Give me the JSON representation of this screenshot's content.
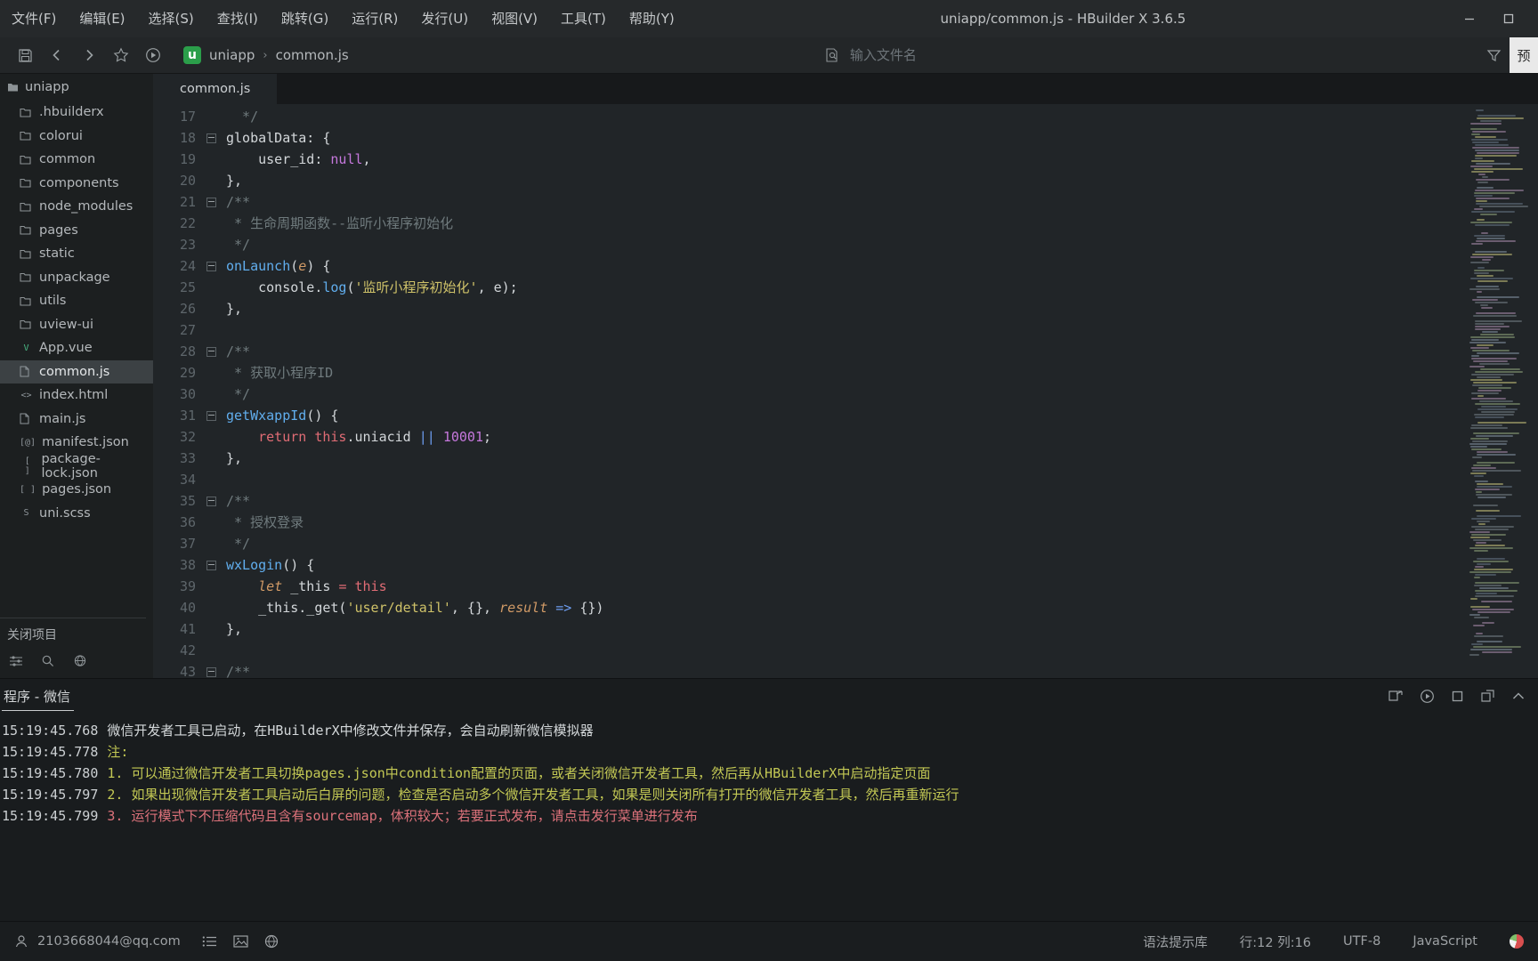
{
  "window": {
    "title": "uniapp/common.js - HBuilder X 3.6.5"
  },
  "menu_items": [
    "文件(F)",
    "编辑(E)",
    "选择(S)",
    "查找(I)",
    "跳转(G)",
    "运行(R)",
    "发行(U)",
    "视图(V)",
    "工具(T)",
    "帮助(Y)"
  ],
  "toolbar": {
    "breadcrumb": {
      "logo": "u",
      "project": "uniapp",
      "separator": "›",
      "file": "common.js"
    },
    "search": {
      "placeholder": "输入文件名"
    },
    "preview_button": "预"
  },
  "sidebar": {
    "root_label": "uniapp",
    "footer_label": "关闭项目",
    "items": [
      {
        "label": ".hbuilderx",
        "icon": "folder",
        "selected": false
      },
      {
        "label": "colorui",
        "icon": "folder",
        "selected": false
      },
      {
        "label": "common",
        "icon": "folder",
        "selected": false
      },
      {
        "label": "components",
        "icon": "folder",
        "selected": false
      },
      {
        "label": "node_modules",
        "icon": "folder",
        "selected": false
      },
      {
        "label": "pages",
        "icon": "folder",
        "selected": false
      },
      {
        "label": "static",
        "icon": "folder",
        "selected": false
      },
      {
        "label": "unpackage",
        "icon": "folder",
        "selected": false
      },
      {
        "label": "utils",
        "icon": "folder",
        "selected": false
      },
      {
        "label": "uview-ui",
        "icon": "folder",
        "selected": false
      },
      {
        "label": "App.vue",
        "icon": "vue",
        "selected": false
      },
      {
        "label": "common.js",
        "icon": "js",
        "selected": true
      },
      {
        "label": "index.html",
        "icon": "html",
        "selected": false
      },
      {
        "label": "main.js",
        "icon": "js",
        "selected": false
      },
      {
        "label": "manifest.json",
        "icon": "jsonat",
        "selected": false
      },
      {
        "label": "package-lock.json",
        "icon": "json",
        "selected": false
      },
      {
        "label": "pages.json",
        "icon": "json",
        "selected": false
      },
      {
        "label": "uni.scss",
        "icon": "scss",
        "selected": false
      }
    ]
  },
  "editor": {
    "active_tab": "common.js",
    "lines": [
      {
        "n": 17,
        "fold": false,
        "tokens": [
          [
            "c",
            "  */"
          ]
        ]
      },
      {
        "n": 18,
        "fold": true,
        "tokens": [
          [
            "d",
            "globalData: {"
          ]
        ]
      },
      {
        "n": 19,
        "fold": false,
        "tokens": [
          [
            "d",
            "    user_id: "
          ],
          [
            "p",
            "null"
          ],
          [
            "d",
            ","
          ]
        ]
      },
      {
        "n": 20,
        "fold": false,
        "tokens": [
          [
            "d",
            "},"
          ]
        ]
      },
      {
        "n": 21,
        "fold": true,
        "tokens": [
          [
            "c",
            "/**"
          ]
        ]
      },
      {
        "n": 22,
        "fold": false,
        "tokens": [
          [
            "c",
            " * 生命周期函数--监听小程序初始化"
          ]
        ]
      },
      {
        "n": 23,
        "fold": false,
        "tokens": [
          [
            "c",
            " */"
          ]
        ]
      },
      {
        "n": 24,
        "fold": true,
        "tokens": [
          [
            "b",
            "onLaunch"
          ],
          [
            "d",
            "("
          ],
          [
            "o",
            "e"
          ],
          [
            "d",
            ") {"
          ]
        ]
      },
      {
        "n": 25,
        "fold": false,
        "tokens": [
          [
            "d",
            "    console."
          ],
          [
            "b",
            "log"
          ],
          [
            "d",
            "("
          ],
          [
            "s",
            "'监听小程序初始化'"
          ],
          [
            "d",
            ", e);"
          ]
        ]
      },
      {
        "n": 26,
        "fold": false,
        "tokens": [
          [
            "d",
            "},"
          ]
        ]
      },
      {
        "n": 27,
        "fold": false,
        "tokens": []
      },
      {
        "n": 28,
        "fold": true,
        "tokens": [
          [
            "c",
            "/**"
          ]
        ]
      },
      {
        "n": 29,
        "fold": false,
        "tokens": [
          [
            "c",
            " * 获取小程序ID"
          ]
        ]
      },
      {
        "n": 30,
        "fold": false,
        "tokens": [
          [
            "c",
            " */"
          ]
        ]
      },
      {
        "n": 31,
        "fold": true,
        "tokens": [
          [
            "b",
            "getWxappId"
          ],
          [
            "d",
            "() {"
          ]
        ]
      },
      {
        "n": 32,
        "fold": false,
        "tokens": [
          [
            "d",
            "    "
          ],
          [
            "r",
            "return"
          ],
          [
            "d",
            " "
          ],
          [
            "r",
            "this"
          ],
          [
            "d",
            ".uniacid "
          ],
          [
            "op",
            "||"
          ],
          [
            "d",
            " "
          ],
          [
            "p",
            "10001"
          ],
          [
            "d",
            ";"
          ]
        ]
      },
      {
        "n": 33,
        "fold": false,
        "tokens": [
          [
            "d",
            "},"
          ]
        ]
      },
      {
        "n": 34,
        "fold": false,
        "tokens": []
      },
      {
        "n": 35,
        "fold": true,
        "tokens": [
          [
            "c",
            "/**"
          ]
        ]
      },
      {
        "n": 36,
        "fold": false,
        "tokens": [
          [
            "c",
            " * 授权登录"
          ]
        ]
      },
      {
        "n": 37,
        "fold": false,
        "tokens": [
          [
            "c",
            " */"
          ]
        ]
      },
      {
        "n": 38,
        "fold": true,
        "tokens": [
          [
            "b",
            "wxLogin"
          ],
          [
            "d",
            "() {"
          ]
        ]
      },
      {
        "n": 39,
        "fold": false,
        "tokens": [
          [
            "d",
            "    "
          ],
          [
            "o",
            "let"
          ],
          [
            "d",
            " _this "
          ],
          [
            "r",
            "="
          ],
          [
            "d",
            " "
          ],
          [
            "r",
            "this"
          ]
        ]
      },
      {
        "n": 40,
        "fold": false,
        "tokens": [
          [
            "d",
            "    _this._get("
          ],
          [
            "s",
            "'user/detail'"
          ],
          [
            "d",
            ", {}, "
          ],
          [
            "o",
            "result"
          ],
          [
            "d",
            " "
          ],
          [
            "op",
            "=>"
          ],
          [
            "d",
            " {})"
          ]
        ]
      },
      {
        "n": 41,
        "fold": false,
        "tokens": [
          [
            "d",
            "},"
          ]
        ]
      },
      {
        "n": 42,
        "fold": false,
        "tokens": []
      },
      {
        "n": 43,
        "fold": true,
        "tokens": [
          [
            "c",
            "/**"
          ]
        ]
      }
    ]
  },
  "console": {
    "active_tab": "程序 - 微信",
    "lines": [
      {
        "time": "15:19:45.768",
        "level": "info",
        "text": "微信开发者工具已启动，在HBuilderX中修改文件并保存，会自动刷新微信模拟器"
      },
      {
        "time": "15:19:45.778",
        "level": "warn",
        "text": "注:"
      },
      {
        "time": "15:19:45.780",
        "level": "warn",
        "text": "1. 可以通过微信开发者工具切换pages.json中condition配置的页面，或者关闭微信开发者工具，然后再从HBuilderX中启动指定页面"
      },
      {
        "time": "15:19:45.797",
        "level": "warn",
        "text": "2. 如果出现微信开发者工具启动后白屏的问题，检查是否启动多个微信开发者工具，如果是则关闭所有打开的微信开发者工具，然后再重新运行"
      },
      {
        "time": "15:19:45.799",
        "level": "error",
        "text": "3. 运行模式下不压缩代码且含有sourcemap，体积较大；若要正式发布，请点击发行菜单进行发布"
      }
    ]
  },
  "status_bar": {
    "account": "2103668044@qq.com",
    "right": [
      {
        "name": "syntax-lib",
        "label": "语法提示库"
      },
      {
        "name": "cursor-position",
        "label": "行:12 列:16"
      },
      {
        "name": "encoding",
        "label": "UTF-8"
      },
      {
        "name": "language",
        "label": "JavaScript"
      }
    ]
  },
  "colors": {
    "accent_green": "#2b9e4a",
    "keyword_red": "#e06c75",
    "function_blue": "#61aeee",
    "string_yellow": "#cfc269",
    "number_purple": "#c678dd",
    "comment_gray": "#6f7a7d",
    "console_warn": "#c3c854",
    "console_error": "#dd727b"
  }
}
